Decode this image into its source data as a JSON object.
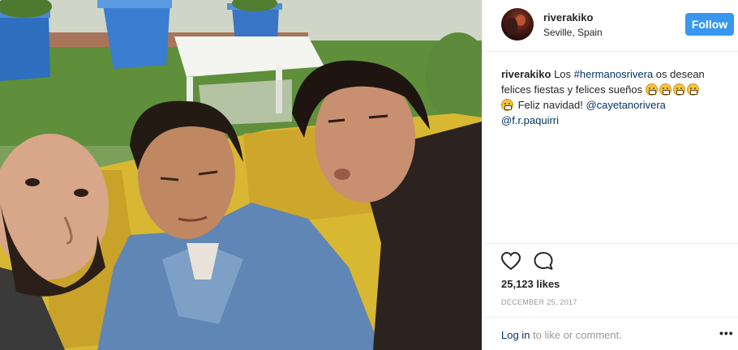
{
  "header": {
    "username": "riverakiko",
    "location": "Seville, Spain",
    "follow_label": "Follow"
  },
  "caption": {
    "username": "riverakiko",
    "text_before_tag": "Los ",
    "hashtag": "#hermanosrivera",
    "text_after_tag": " os desean felices fiestas y felices sueños ",
    "line2_text": " Feliz navidad! ",
    "mention1": "@cayetanorivera",
    "mention2": "@f.r.paquirri",
    "emoji_icon": "grimacing-face-emoji"
  },
  "actions": {
    "like_icon": "heart-icon",
    "comment_icon": "comment-icon"
  },
  "stats": {
    "likes": "25,123 likes",
    "date": "DECEMBER 25, 2017"
  },
  "footer": {
    "login_link": "Log in",
    "login_rest": " to like or comment.",
    "more_label": "•••"
  },
  "colors": {
    "accent": "#3897f0",
    "link": "#003569",
    "muted": "#999999",
    "text": "#262626"
  }
}
